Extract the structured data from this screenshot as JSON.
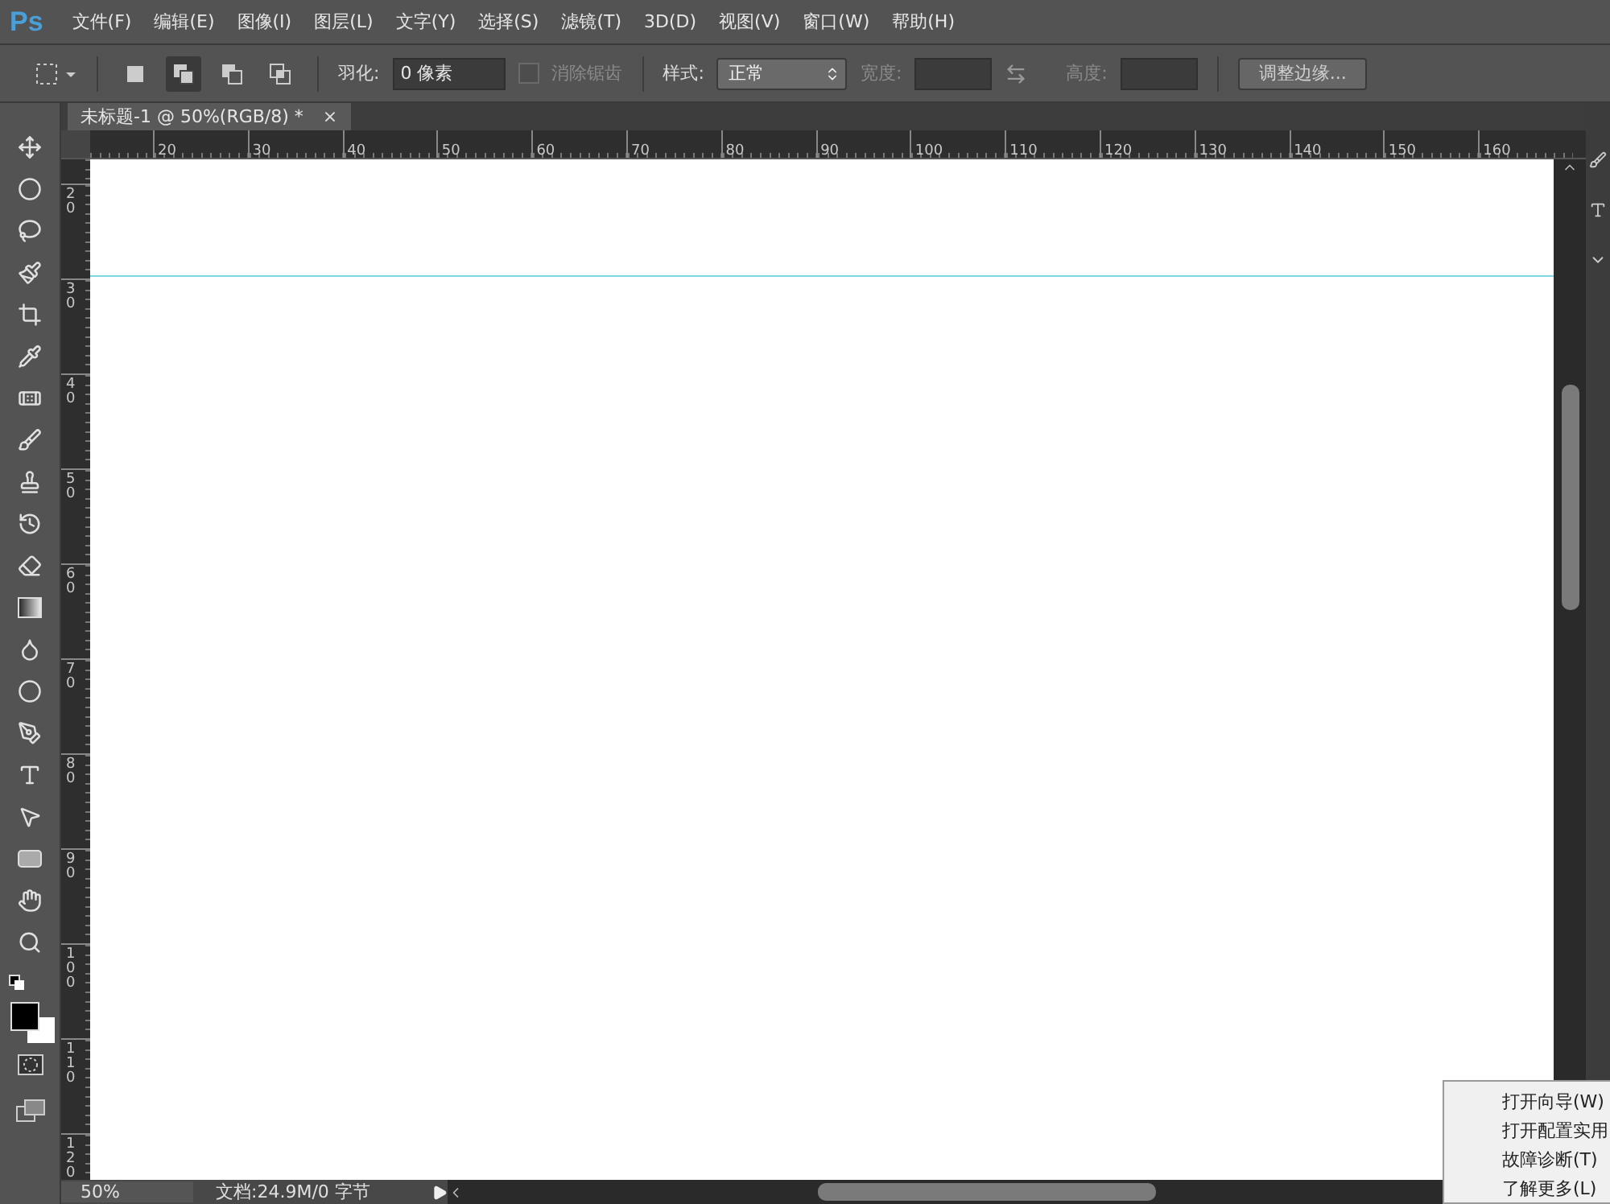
{
  "logo": "Ps",
  "menu": [
    "文件(F)",
    "编辑(E)",
    "图像(I)",
    "图层(L)",
    "文字(Y)",
    "选择(S)",
    "滤镜(T)",
    "3D(D)",
    "视图(V)",
    "窗口(W)",
    "帮助(H)"
  ],
  "options": {
    "modes": [
      {
        "selected": false
      },
      {
        "selected": true
      },
      {
        "selected": false
      },
      {
        "selected": false
      }
    ],
    "feather_label": "羽化:",
    "feather_value": "0 像素",
    "antialias": {
      "label": "消除锯齿",
      "checked": false,
      "disabled": true
    },
    "style_label": "样式:",
    "style_value": "正常",
    "width_label": "宽度:",
    "height_label": "高度:",
    "refine_button": "调整边缘..."
  },
  "document_tab": {
    "title": "未标题-1 @ 50%(RGB/8) *",
    "close": "×"
  },
  "ruler_h": [
    "20",
    "30",
    "40",
    "50",
    "60",
    "70",
    "80",
    "90",
    "100",
    "110",
    "120",
    "130",
    "140",
    "150",
    "160"
  ],
  "ruler_v": [
    "20",
    "30",
    "40",
    "50",
    "60",
    "70",
    "80",
    "90",
    "100",
    "110",
    "120"
  ],
  "status_bar": {
    "zoom": "50%",
    "doc_info": "文档:24.9M/0 字节"
  },
  "context_menu": [
    "打开向导(W)",
    "打开配置实用",
    "故障诊断(T)",
    "了解更多(L)"
  ]
}
